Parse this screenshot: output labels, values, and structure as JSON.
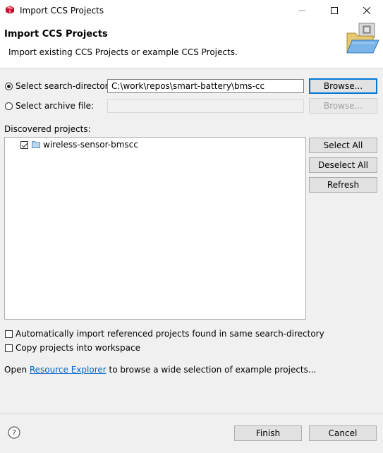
{
  "window": {
    "title": "Import CCS Projects",
    "icons": {
      "app": "ccs-app-icon",
      "minimize": "minimize-icon",
      "maximize": "maximize-icon",
      "close": "close-icon"
    }
  },
  "header": {
    "title": "Import CCS Projects",
    "description": "Import existing CCS Projects or example CCS Projects.",
    "image": "import-folder-icon"
  },
  "source": {
    "search_dir_label": "Select search-directory:",
    "search_dir_value": "C:\\work\\repos\\smart-battery\\bms-cc",
    "search_dir_selected": true,
    "archive_label": "Select archive file:",
    "archive_value": "",
    "browse_label": "Browse...",
    "browse_archive_label": "Browse..."
  },
  "projects": {
    "label": "Discovered projects:",
    "items": [
      {
        "name": "wireless-sensor-bmscc",
        "checked": true,
        "icon": "project-folder-icon"
      }
    ],
    "select_all": "Select All",
    "deselect_all": "Deselect All",
    "refresh": "Refresh"
  },
  "options": {
    "auto_import_label": "Automatically import referenced projects found in same search-directory",
    "auto_import_checked": false,
    "copy_label": "Copy projects into workspace",
    "copy_checked": false
  },
  "resource": {
    "prefix": "Open ",
    "link": "Resource Explorer",
    "suffix": " to browse a wide selection of example projects..."
  },
  "footer": {
    "help_icon": "help-icon",
    "finish": "Finish",
    "cancel": "Cancel"
  },
  "colors": {
    "link": "#0066cc",
    "focus": "#0078d7",
    "background": "#f0f0f0"
  }
}
